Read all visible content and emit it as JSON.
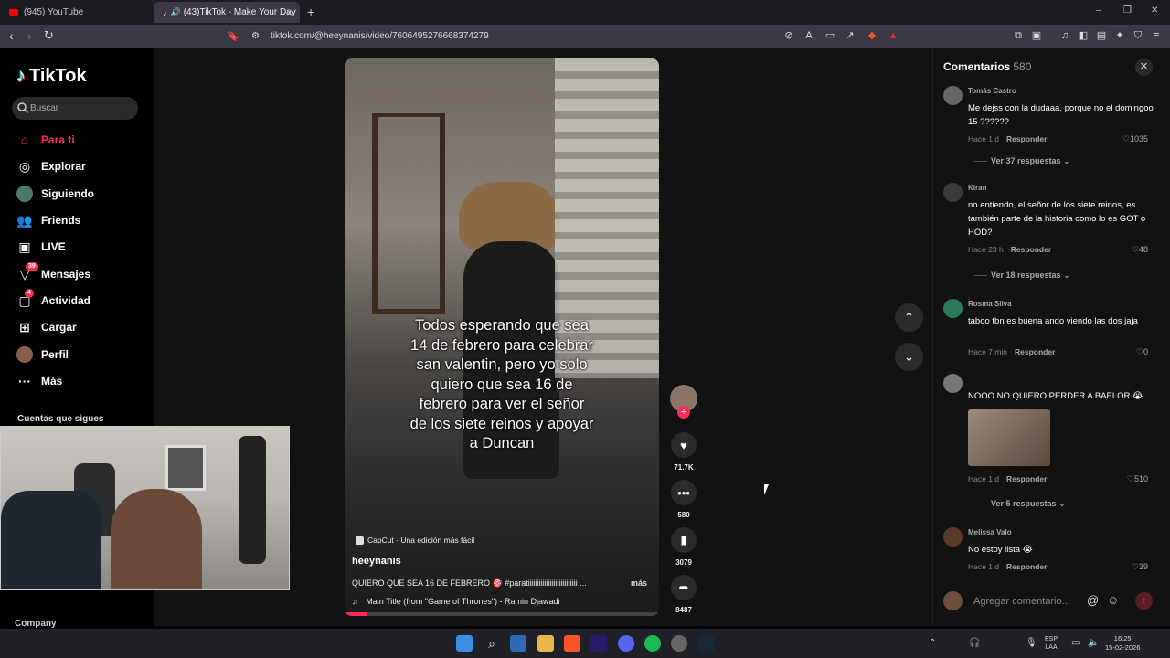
{
  "browser": {
    "tabs": [
      {
        "label": "(945) YouTube",
        "active": false
      },
      {
        "label": "(43)TikTok - Make Your Day",
        "active": true
      }
    ],
    "url": "tiktok.com/@heeynanis/video/7606495276668374279",
    "new_tab": "+",
    "window_controls": {
      "minimize": "–",
      "maximize": "❐",
      "close": "✕"
    }
  },
  "sidebar": {
    "logo": "TikTok",
    "search_placeholder": "Buscar",
    "items": [
      {
        "label": "Para ti",
        "icon": "home-icon",
        "active": true
      },
      {
        "label": "Explorar",
        "icon": "compass-icon"
      },
      {
        "label": "Siguiendo",
        "icon": "following-avatar-icon"
      },
      {
        "label": "Friends",
        "icon": "friends-icon"
      },
      {
        "label": "LIVE",
        "icon": "live-icon"
      },
      {
        "label": "Mensajes",
        "icon": "messages-icon",
        "badge": "39"
      },
      {
        "label": "Actividad",
        "icon": "activity-icon",
        "badge": "4"
      },
      {
        "label": "Cargar",
        "icon": "upload-icon"
      },
      {
        "label": "Perfil",
        "icon": "profile-avatar-icon"
      },
      {
        "label": "Más",
        "icon": "more-icon"
      }
    ],
    "following_heading": "Cuentas que sigues",
    "footer": "Company"
  },
  "video": {
    "caption": "Todos esperando que sea\n14 de febrero para celebrar\nsan valentin, pero yo solo\nquiero que sea 16 de\nfebrero para ver el señor\nde los siete reinos y apoyar\na Duncan",
    "capcut": "CapCut · Una edición más fácil",
    "author": "heeynanis",
    "description": "QUIERO QUE SEA 16 DE FEBRERO 🎯 #paratiiiiiiiiiiiiiiiiiiiiiiiiiii ...",
    "more": "más",
    "music": "Main Title (from \"Game of Thrones\") - Ramin Djawadi",
    "progress": 0.07
  },
  "actions": {
    "likes": "71.7K",
    "comments": "580",
    "saves": "3079",
    "shares": "8487"
  },
  "comments": {
    "title": "Comentarios",
    "count": "580",
    "reply_label": "Responder",
    "items": [
      {
        "user": "Tomás Castro",
        "text": "Me dejss con la dudaaa, porque no el domingoo 15 ??????",
        "time": "Hace 1 d",
        "likes": "1035",
        "replies": "Ver 37 respuestas"
      },
      {
        "user": "Kiran",
        "text": "no entiendo, el señor de los siete reinos, es también parte de la historia como lo es GOT o HOD?",
        "time": "Hace 23 h",
        "likes": "48",
        "replies": "Ver 18 respuestas"
      },
      {
        "user": "Rosma Silva",
        "text": "taboo tbn es buena ando viendo las dos jaja",
        "time": "Hace 7 min",
        "likes": "0"
      },
      {
        "user": "",
        "text": "NOOO NO QUIERO PERDER A BAELOR 😭",
        "time": "Hace 1 d",
        "likes": "510",
        "replies": "Ver 5 respuestas"
      },
      {
        "user": "Melissa Valo",
        "text": "No estoy lista 😭",
        "time": "Hace 1 d",
        "likes": "39"
      }
    ],
    "input_placeholder": "Agregar comentario..."
  },
  "taskbar": {
    "lang": "ESP",
    "lang2": "LAA",
    "time": "16:25",
    "date": "15-02-2026"
  },
  "colors": {
    "accent": "#fe2c55",
    "background": "#121212"
  }
}
